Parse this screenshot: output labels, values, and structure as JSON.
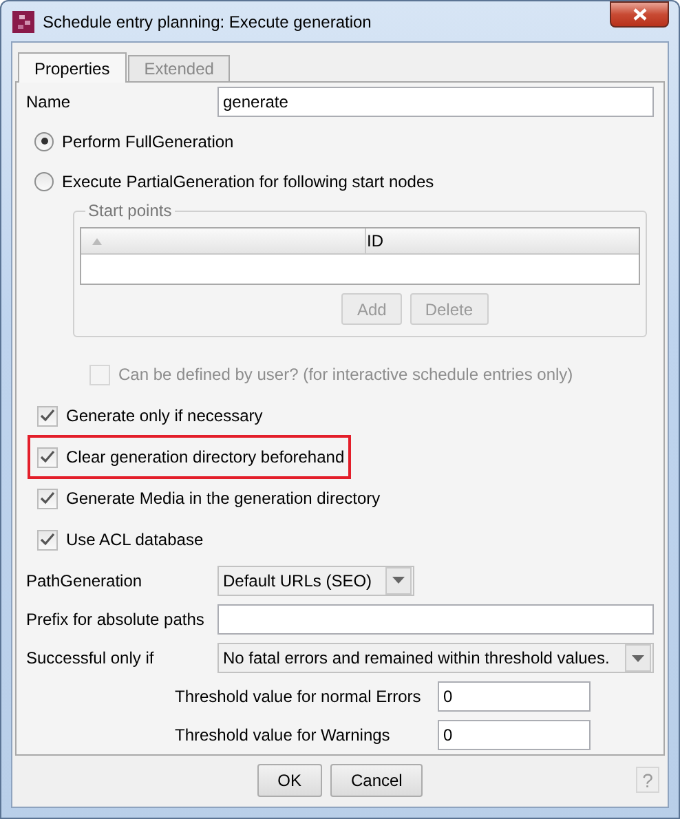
{
  "window": {
    "title": "Schedule entry planning: Execute generation"
  },
  "tabs": [
    {
      "label": "Properties",
      "selected": true
    },
    {
      "label": "Extended",
      "selected": false
    }
  ],
  "name": {
    "label": "Name",
    "value": "generate"
  },
  "generation_mode": [
    {
      "label": "Perform FullGeneration",
      "selected": true
    },
    {
      "label": "Execute PartialGeneration for following start nodes",
      "selected": false
    }
  ],
  "start_points": {
    "title": "Start points",
    "columns": [
      {
        "sort_indicator": true
      },
      {
        "label": "ID"
      }
    ],
    "buttons": [
      {
        "label": "Add",
        "disabled": true
      },
      {
        "label": "Delete",
        "disabled": true
      }
    ]
  },
  "user_definable": {
    "label": "Can be defined by user? (for interactive schedule entries only)",
    "checked": false,
    "disabled": true
  },
  "options": [
    {
      "label": "Generate only if necessary",
      "checked": true,
      "highlighted": false
    },
    {
      "label": "Clear generation directory beforehand",
      "checked": true,
      "highlighted": true
    },
    {
      "label": "Generate Media in the generation directory",
      "checked": true,
      "highlighted": false
    },
    {
      "label": "Use ACL database",
      "checked": true,
      "highlighted": false
    }
  ],
  "path_generation": {
    "label": "PathGeneration",
    "value": "Default URLs (SEO)"
  },
  "prefix": {
    "label": "Prefix for absolute paths"
  },
  "successful_only_if": {
    "label": "Successful only if",
    "value": "No fatal errors and remained within threshold values."
  },
  "thresholds": [
    {
      "label": "Threshold value for normal Errors",
      "value": "0"
    },
    {
      "label": "Threshold value for Warnings",
      "value": "0"
    }
  ],
  "footer_buttons": [
    {
      "label": "OK"
    },
    {
      "label": "Cancel"
    }
  ],
  "help": "?"
}
